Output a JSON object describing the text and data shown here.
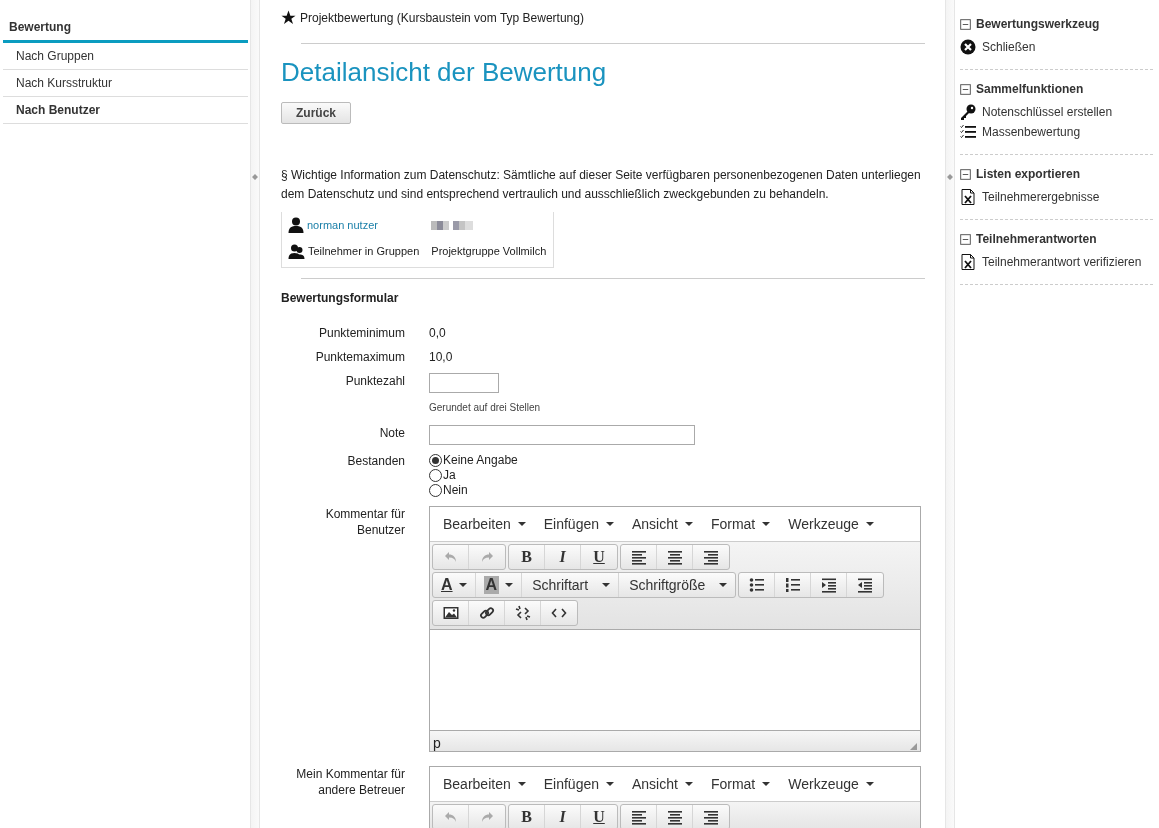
{
  "sidebar": {
    "title": "Bewertung",
    "items": [
      {
        "label": "Nach Gruppen",
        "selected": false
      },
      {
        "label": "Nach Kursstruktur",
        "selected": false
      },
      {
        "label": "Nach Benutzer",
        "selected": true
      }
    ]
  },
  "main": {
    "breadcrumb": "Projektbewertung (Kursbaustein vom Typ Bewertung)",
    "title": "Detailansicht der Bewertung",
    "back_button": "Zurück",
    "privacy_notice": "§ Wichtige Information zum Datenschutz: Sämtliche auf dieser Seite verfügbaren personenbezogenen Daten unterliegen dem Datenschutz und sind entsprechend vertraulich und ausschließlich zweckgebunden zu behandeln.",
    "identity": [
      {
        "kind": "user",
        "label": "norman nutzer"
      },
      {
        "kind": "groups",
        "label": "Teilnehmer in Gruppen",
        "value": "Projektgruppe Vollmilch"
      }
    ],
    "form": {
      "title": "Bewertungsformular",
      "fields": [
        {
          "kind": "static",
          "label": "Punkteminimum",
          "value": "0,0"
        },
        {
          "kind": "static",
          "label": "Punktemaximum",
          "value": "10,0"
        },
        {
          "kind": "short-input",
          "label": "Punktezahl",
          "hint": "Gerundet auf drei Stellen"
        },
        {
          "kind": "long-input",
          "label": "Note"
        },
        {
          "kind": "radio",
          "label": "Bestanden",
          "options": [
            {
              "label": "Keine Angabe",
              "selected": true
            },
            {
              "label": "Ja",
              "selected": false
            },
            {
              "label": "Nein",
              "selected": false
            }
          ]
        },
        {
          "kind": "editor",
          "label": "Kommentar für Benutzer",
          "menus": [
            "Bearbeiten",
            "Einfügen",
            "Ansicht",
            "Format",
            "Werkzeuge"
          ],
          "status": "p",
          "toolbar": [
            [
              [
                {
                  "kind": "undo",
                  "disabled": true
                },
                {
                  "kind": "redo",
                  "disabled": true
                }
              ],
              [
                {
                  "kind": "bold",
                  "text": "B"
                },
                {
                  "kind": "italic",
                  "text": "I"
                },
                {
                  "kind": "underline",
                  "text": "U"
                }
              ],
              [
                {
                  "kind": "align-left"
                },
                {
                  "kind": "align-center"
                },
                {
                  "kind": "align-right"
                }
              ]
            ],
            [
              [
                {
                  "kind": "text-color",
                  "text": "A"
                },
                {
                  "kind": "background-color",
                  "text": "A"
                },
                {
                  "kind": "dropdown",
                  "text": "Schriftart"
                },
                {
                  "kind": "dropdown",
                  "text": "Schriftgröße"
                }
              ],
              [
                {
                  "kind": "bullet-list"
                },
                {
                  "kind": "numbered-list"
                },
                {
                  "kind": "indent"
                },
                {
                  "kind": "outdent"
                }
              ]
            ],
            [
              [
                {
                  "kind": "image"
                },
                {
                  "kind": "link"
                },
                {
                  "kind": "unlink"
                },
                {
                  "kind": "code"
                }
              ]
            ]
          ]
        },
        {
          "kind": "editor",
          "label": "Mein Kommentar für andere Betreuer",
          "menus": [
            "Bearbeiten",
            "Einfügen",
            "Ansicht",
            "Format",
            "Werkzeuge"
          ],
          "toolbar": [
            [
              [
                {
                  "kind": "undo",
                  "disabled": true
                },
                {
                  "kind": "redo",
                  "disabled": true
                }
              ],
              [
                {
                  "kind": "bold",
                  "text": "B"
                },
                {
                  "kind": "italic",
                  "text": "I"
                },
                {
                  "kind": "underline",
                  "text": "U"
                }
              ],
              [
                {
                  "kind": "align-left"
                },
                {
                  "kind": "align-center"
                },
                {
                  "kind": "align-right"
                }
              ]
            ]
          ]
        }
      ]
    }
  },
  "tools": {
    "sections": [
      {
        "title": "Bewertungswerkzeug",
        "items": [
          {
            "kind": "close",
            "label": "Schließen"
          }
        ]
      },
      {
        "title": "Sammelfunktionen",
        "items": [
          {
            "kind": "key",
            "label": "Notenschlüssel erstellen"
          },
          {
            "kind": "checklist",
            "label": "Massenbewertung"
          }
        ]
      },
      {
        "title": "Listen exportieren",
        "items": [
          {
            "kind": "excel",
            "label": "Teilnehmerergebnisse"
          }
        ]
      },
      {
        "title": "Teilnehmerantworten",
        "items": [
          {
            "kind": "excel",
            "label": "Teilnehmerantwort verifizieren"
          }
        ]
      }
    ]
  }
}
